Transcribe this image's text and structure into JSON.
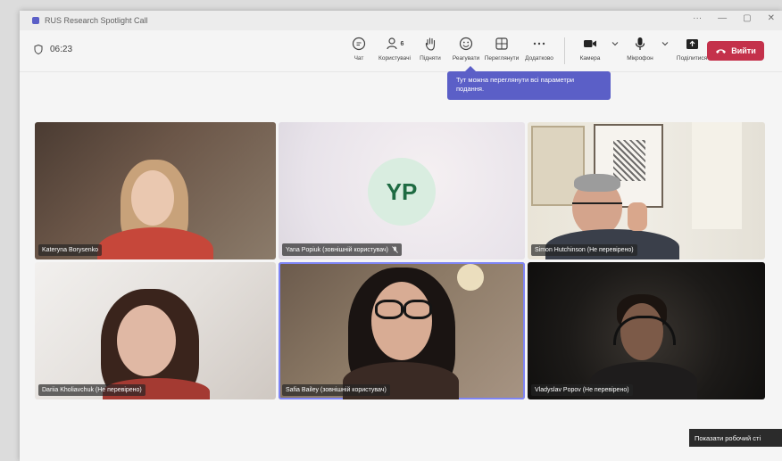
{
  "window": {
    "title": "RUS Research Spotlight Call",
    "controls": [
      "···",
      "—",
      "▢",
      "✕"
    ]
  },
  "toolbar": {
    "timer": "06:23",
    "tools": [
      {
        "label": "Чат",
        "icon": "chat-icon"
      },
      {
        "label": "Користувачі",
        "icon": "people-icon",
        "badge": "6"
      },
      {
        "label": "Підняти",
        "icon": "raise-hand-icon"
      },
      {
        "label": "Реагувати",
        "icon": "react-icon"
      },
      {
        "label": "Переглянути",
        "icon": "view-icon"
      },
      {
        "label": "Додатково",
        "icon": "more-icon"
      }
    ],
    "devices": [
      {
        "label": "Камера",
        "icon": "camera-icon"
      },
      {
        "label": "Мікрофон",
        "icon": "mic-icon"
      },
      {
        "label": "Поділитися",
        "icon": "share-icon"
      }
    ],
    "leave_label": "Вийти"
  },
  "tooltip": {
    "text": "Тут можна переглянути всі параметри подання."
  },
  "participants": [
    {
      "name": "Kateryna Borysenko"
    },
    {
      "name": "Yana Popiuk (зовнішній користувач)",
      "initials": "YP",
      "muted": true
    },
    {
      "name": "Simon Hutchinson (Не перевірено)"
    },
    {
      "name": "Dariia Kholiavchuk (Не перевірено)"
    },
    {
      "name": "Safia Bailey (зовнішній користувач)",
      "active": true
    },
    {
      "name": "Vladyslav Popov (Не перевірено)"
    }
  ],
  "share_tooltip": "Показати робочий сті",
  "colors": {
    "accent": "#5b5fc7",
    "leave": "#c4314b",
    "avatar_bg": "#d9ede0",
    "avatar_text": "#1e6b42"
  }
}
